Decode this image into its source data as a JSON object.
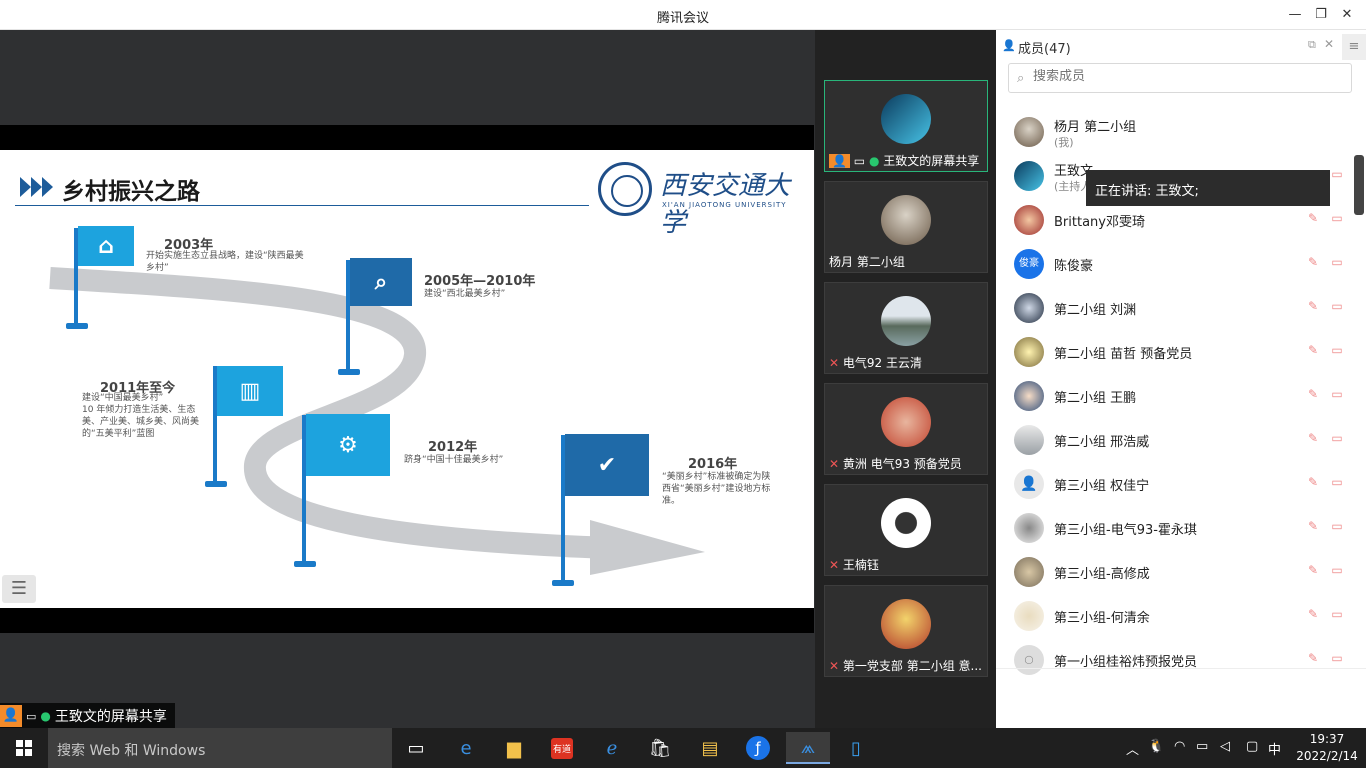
{
  "window": {
    "title": "腾讯会议"
  },
  "slide": {
    "title": "乡村振兴之路",
    "logo_text": "西安交通大学",
    "logo_sub": "XI'AN JIAOTONG UNIVERSITY",
    "milestones": [
      {
        "year": "2003年",
        "desc": "开始实施生态立县战略，建设“陕西最美乡村”"
      },
      {
        "year": "2005年—2010年",
        "desc": "建设“西北最美乡村”"
      },
      {
        "year": "2011年至今",
        "desc": "建设“中国最美乡村”\n10 年倾力打造生活美、生态美、产业美、城乡美、风尚美的“五美平利”蓝图"
      },
      {
        "year": "2012年",
        "desc": "跻身“中国十佳最美乡村”"
      },
      {
        "year": "2016年",
        "desc": "“美丽乡村”标准被确定为陕西省“美丽乡村”建设地方标准。"
      }
    ]
  },
  "share_badge": {
    "label": "王致文的屏幕共享"
  },
  "video_tiles": [
    {
      "name": "王致文的屏幕共享"
    },
    {
      "name": "杨月  第二小组"
    },
    {
      "name": "电气92 王云清"
    },
    {
      "name": "黄洲 电气93 预备党员"
    },
    {
      "name": "王楠钰"
    },
    {
      "name": "第一党支部  第二小组 意..."
    }
  ],
  "members_panel": {
    "title": "成员(47)",
    "search_placeholder": "搜索成员",
    "speaking": "正在讲话: 王致文;",
    "members": [
      {
        "name": "杨月  第二小组",
        "sub": "(我)"
      },
      {
        "name": "王致文",
        "sub": "(主持人)"
      },
      {
        "name": "Brittany邓雯琦"
      },
      {
        "name": "陈俊豪",
        "avatar_text": "俊豪"
      },
      {
        "name": "第二小组 刘渊"
      },
      {
        "name": "第二小组 苗哲 预备党员"
      },
      {
        "name": "第二小组 王鹏"
      },
      {
        "name": "第二小组 邢浩威"
      },
      {
        "name": "第三小组 权佳宁"
      },
      {
        "name": "第三小组-电气93-霍永琪"
      },
      {
        "name": "第三小组-高修成"
      },
      {
        "name": "第三小组-何清余"
      },
      {
        "name": "第一小组桂裕炜预报党员"
      }
    ]
  },
  "taskbar": {
    "search_placeholder": "搜索 Web 和 Windows",
    "ime": "中",
    "time": "19:37",
    "date": "2022/2/14"
  }
}
